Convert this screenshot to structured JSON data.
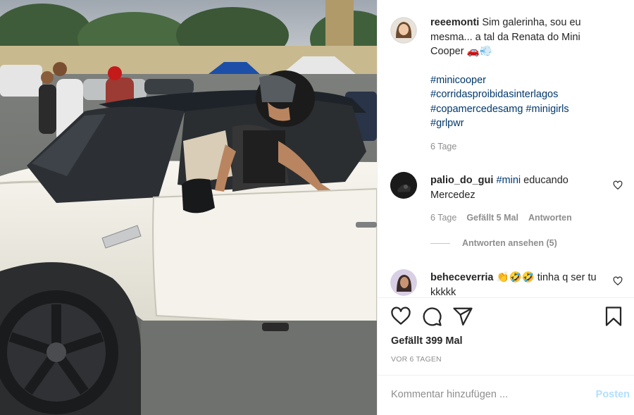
{
  "post": {
    "author": "reeemonti",
    "caption_text": "Sim galerinha, sou eu mesma... a tal da Renata do Mini Cooper 🚗💨",
    "hashtags_line1": "#minicooper",
    "hashtags_line2": "#corridasproibidasinterlagos",
    "hashtags_line3_a": "#copamercedesamg",
    "hashtags_line3_b": "#minigirls",
    "hashtags_line4": "#grlpwr",
    "age": "6 Tage"
  },
  "comments": [
    {
      "username": "palio_do_gui",
      "hashtag": "#mini",
      "text": "educando Mercedez",
      "age": "6 Tage",
      "likes": "Gefällt 5 Mal",
      "reply": "Antworten",
      "view_replies": "Antworten ansehen (5)"
    },
    {
      "username": "beheceverria",
      "emoji": "👏🤣🤣",
      "text": "tinha q ser tu kkkkk"
    }
  ],
  "footer": {
    "likes_text": "Gefällt 399 Mal",
    "date_text": "VOR 6 TAGEN",
    "comment_placeholder": "Kommentar hinzufügen ...",
    "post_label": "Posten"
  },
  "colors": {
    "hashtag": "#00376b",
    "muted": "#8e8e8e",
    "post_button": "#b2dffc",
    "car_body": "#f1efe6"
  }
}
